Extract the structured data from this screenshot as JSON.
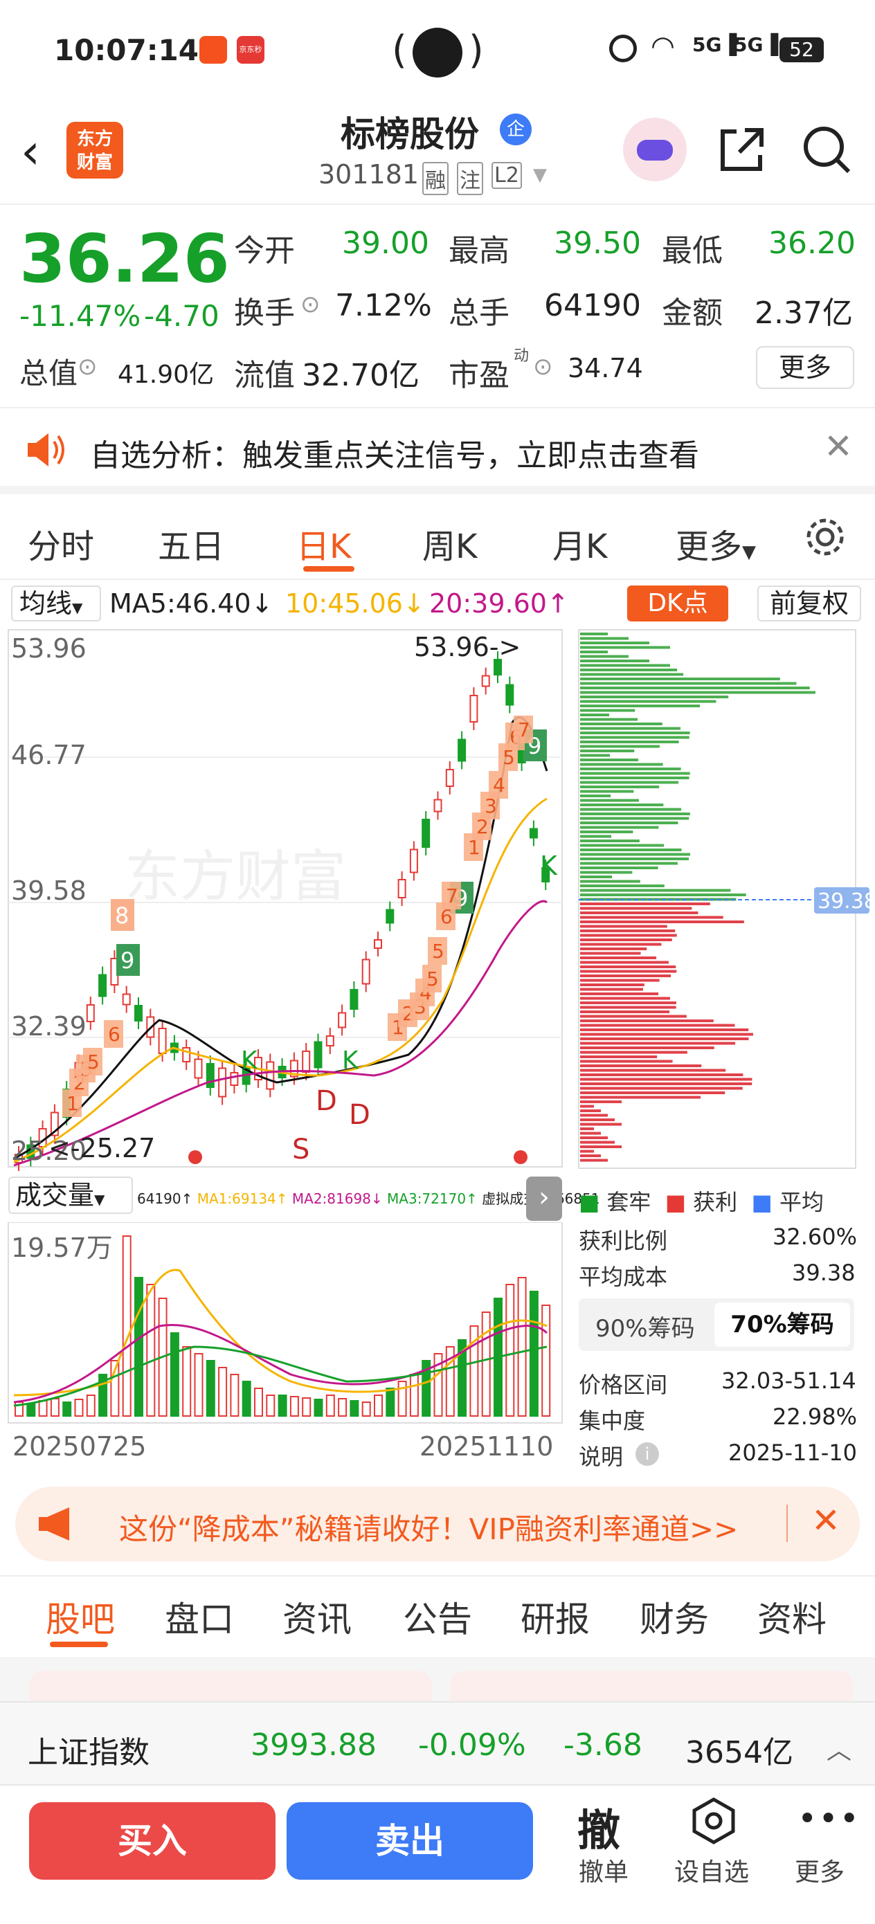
{
  "status": {
    "time": "10:07:14",
    "battery": "52",
    "app_badge": "京东秒送"
  },
  "header": {
    "logo_line1": "东方",
    "logo_line2": "财富",
    "name": "标榜股份",
    "name_badge": "企",
    "code": "301181",
    "tag1": "融",
    "tag2": "注",
    "tag3": "L2"
  },
  "quote": {
    "price": "36.26",
    "change_pct": "-11.47%",
    "change": "-4.70",
    "open_label": "今开",
    "open": "39.00",
    "high_label": "最高",
    "high": "39.50",
    "low_label": "最低",
    "low": "36.20",
    "turnover_label": "换手",
    "turnover": "7.12%",
    "vol_label": "总手",
    "vol": "64190",
    "amount_label": "金额",
    "amount": "2.37亿",
    "mcap_label": "总值",
    "mcap": "41.90亿",
    "float_label": "流值",
    "float_val": "32.70亿",
    "pe_label": "市盈",
    "pe_sup": "动",
    "pe": "34.74",
    "more": "更多"
  },
  "notice": {
    "text": "自选分析：触发重点关注信号，立即点击查看"
  },
  "tabs": [
    "分时",
    "五日",
    "日K",
    "周K",
    "月K",
    "更多"
  ],
  "chart": {
    "ma_select": "均线",
    "ma5": "MA5:46.40↓",
    "ma10": "10:45.06↓",
    "ma20": "20:39.60↑",
    "dk": "DK点",
    "fq": "前复权",
    "y_labels": [
      "53.96",
      "46.77",
      "39.58",
      "32.39",
      "25.20"
    ],
    "high_mark": "53.96->",
    "low_mark": "<-25.27",
    "cost_tag": "39.38",
    "vol_select": "成交量",
    "vol_stats": "64190↑",
    "vol_ma1": "MA1:69134↑",
    "vol_ma2": "MA2:81698↓",
    "vol_ma3": "MA3:72170↑",
    "vol_virtual": "虚拟成交量:66851",
    "vol_max": "19.57万",
    "date_start": "20250725",
    "date_end": "20251110",
    "signal_s": "S",
    "signal_d1": "D",
    "signal_d2": "D",
    "signal_k1": "K",
    "signal_k2": "K",
    "signal_k3": "K",
    "watermark": "东方财富"
  },
  "chip": {
    "legend_trap": "套牢",
    "legend_profit": "获利",
    "legend_avg": "平均",
    "profit_ratio_label": "获利比例",
    "profit_ratio": "32.60%",
    "avg_cost_label": "平均成本",
    "avg_cost": "39.38",
    "tab90": "90%筹码",
    "tab70": "70%筹码",
    "range_label": "价格区间",
    "range": "32.03-51.14",
    "conc_label": "集中度",
    "conc": "22.98%",
    "note_label": "说明",
    "note_date": "2025-11-10"
  },
  "banner": {
    "text": "这份“降成本”秘籍请收好！VIP融资利率通道>>"
  },
  "page_tabs": [
    "股吧",
    "盘口",
    "资讯",
    "公告",
    "研报",
    "财务",
    "资料"
  ],
  "index": {
    "name": "上证指数",
    "value": "3993.88",
    "pct": "-0.09%",
    "chg": "-3.68",
    "amount": "3654亿"
  },
  "bottom": {
    "buy": "买入",
    "sell": "卖出",
    "cancel_icon": "撤",
    "cancel": "撤单",
    "set_alert": "设自选",
    "more": "更多"
  }
}
